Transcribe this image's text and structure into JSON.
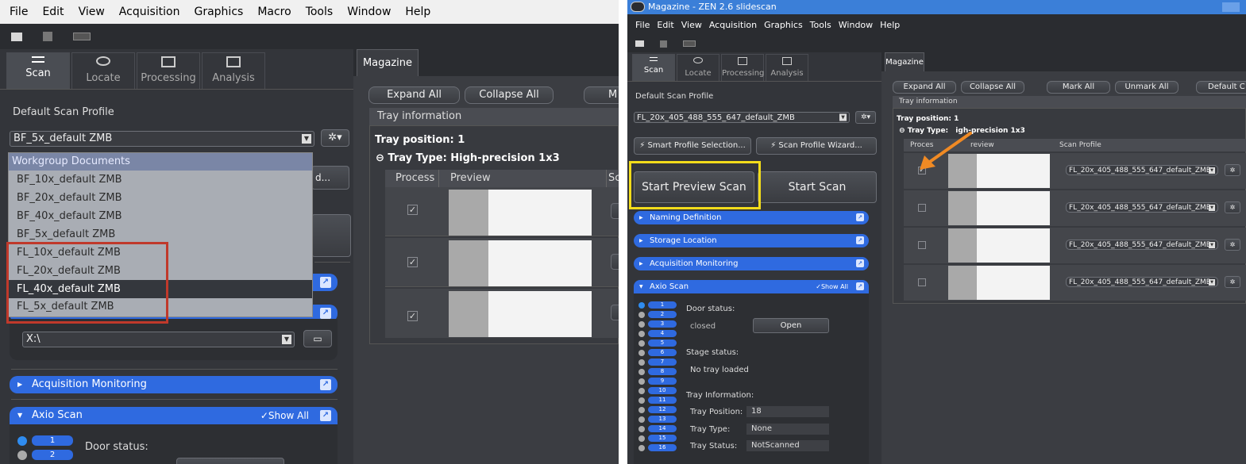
{
  "left": {
    "menu": [
      "File",
      "Edit",
      "View",
      "Acquisition",
      "Graphics",
      "Macro",
      "Tools",
      "Window",
      "Help"
    ],
    "tabs": [
      "Scan",
      "Locate",
      "Processing",
      "Analysis"
    ],
    "default_scan_profile_label": "Default Scan Profile",
    "profile_value": "BF_5x_default ZMB",
    "dropdown_items": [
      "Workgroup Documents",
      "BF_10x_default ZMB",
      "BF_20x_default ZMB",
      "BF_40x_default ZMB",
      "BF_5x_default ZMB",
      "FL_10x_default ZMB",
      "FL_20x_default ZMB",
      "FL_40x_default ZMB",
      "FL_5x_default ZMB"
    ],
    "wizard_fragment": "d...",
    "storage_path": "X:\\",
    "acquisition_monitoring": "Acquisition Monitoring",
    "axio_scan": "Axio Scan",
    "show_all": "✓Show All",
    "door_status": "Door status:",
    "slots": [
      "1",
      "2"
    ],
    "magazine_tab": "Magazine",
    "expand_all": "Expand All",
    "collapse_all": "Collapse All",
    "mark_fragment": "M",
    "tray_information": "Tray information",
    "tray_position": "Tray position:  1",
    "tray_type": "Tray Type:  High-precision 1x3",
    "col_process": "Process",
    "col_preview": "Preview",
    "col_scan_fragment": "Sc",
    "rows_checked": [
      "✓",
      "✓",
      "✓"
    ]
  },
  "right": {
    "title": "Magazine - ZEN 2.6 slidescan",
    "menu": [
      "File",
      "Edit",
      "View",
      "Acquisition",
      "Graphics",
      "Tools",
      "Window",
      "Help"
    ],
    "tabs": [
      "Scan",
      "Locate",
      "Processing",
      "Analysis"
    ],
    "default_scan_profile_label": "Default Scan Profile",
    "profile_value": "FL_20x_405_488_555_647_default_ZMB",
    "smart_profile": "Smart Profile Selection...",
    "profile_wizard": "Scan Profile Wizard...",
    "start_preview_scan": "Start Preview Scan",
    "start_scan": "Start Scan",
    "naming_definition": "Naming Definition",
    "storage_location": "Storage Location",
    "acquisition_monitoring": "Acquisition Monitoring",
    "axio_scan": "Axio Scan",
    "show_all": "✓Show All",
    "door_status": "Door status:",
    "door_value": "closed",
    "open_button": "Open",
    "stage_status": "Stage status:",
    "stage_value": "No tray loaded",
    "tray_information_label": "Tray Information:",
    "tray_position_label": "Tray Position:",
    "tray_position_value": "18",
    "tray_type_label": "Tray Type:",
    "tray_type_value": "None",
    "tray_status_label": "Tray Status:",
    "tray_status_value": "NotScanned",
    "slots": [
      "1",
      "2",
      "3",
      "4",
      "5",
      "6",
      "7",
      "8",
      "9",
      "10",
      "11",
      "12",
      "13",
      "14",
      "15",
      "16"
    ],
    "magazine_tab": "Magazine",
    "expand_all": "Expand All",
    "collapse_all": "Collapse All",
    "mark_all": "Mark All",
    "unmark_all": "Unmark All",
    "default_fragment": "Default C",
    "tray_information": "Tray information",
    "tray_position": "Tray position:  1",
    "tray_type_left": "Tray Type:",
    "tray_type_right": "igh-precision 1x3",
    "col_process": "Proces",
    "col_preview": "review",
    "col_scan_profile": "Scan Profile",
    "row_profile": "FL_20x_405_488_555_647_default_ZMB",
    "rows_checked": [
      "✓",
      "",
      "",
      ""
    ]
  },
  "colors": {
    "accent_blue": "#2f6ae0",
    "highlight_red": "#c0392b",
    "highlight_yellow": "#f2dc1b",
    "arrow_orange": "#f08a24"
  }
}
